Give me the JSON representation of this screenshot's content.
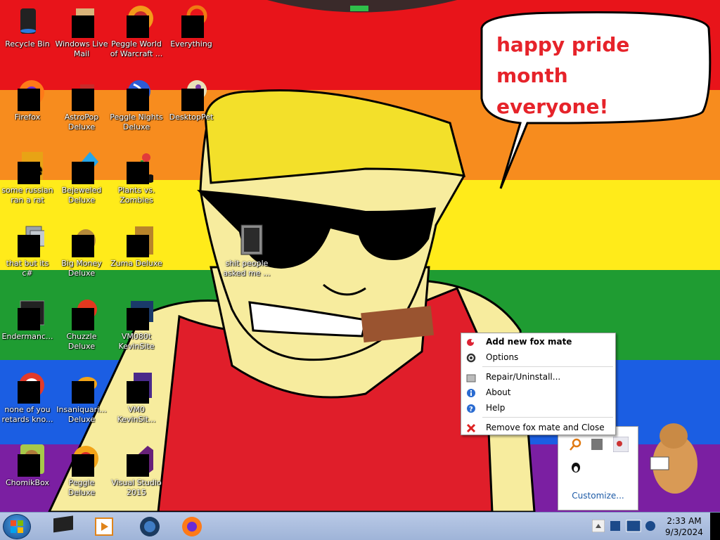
{
  "wallpaper": {
    "stripe_colors": [
      "#e8141a",
      "#f78c1e",
      "#ffeb1a",
      "#1f9c32",
      "#1b5ee3",
      "#7b1fa2"
    ],
    "speech_bubble": {
      "line1": "happy pride month",
      "line2": "everyone!"
    }
  },
  "desktop_icons": [
    {
      "label": "Recycle Bin",
      "icon": "recycle-bin-icon"
    },
    {
      "label": "Windows Live Mail",
      "icon": "windows-live-mail-icon"
    },
    {
      "label": "Peggle World of Warcraft ...",
      "icon": "peggle-wow-icon"
    },
    {
      "label": "Everything",
      "icon": "everything-search-icon"
    },
    {
      "label": "Firefox",
      "icon": "firefox-icon"
    },
    {
      "label": "AstroPop Deluxe",
      "icon": "astropop-icon"
    },
    {
      "label": "Peggle Nights Deluxe",
      "icon": "peggle-nights-icon"
    },
    {
      "label": "DesktopPet",
      "icon": "desktoppet-icon"
    },
    {
      "label": "some russian ran a rat",
      "icon": "folder-icon"
    },
    {
      "label": "Bejeweled Deluxe",
      "icon": "bejeweled-icon"
    },
    {
      "label": "Plants vs. Zombies",
      "icon": "plants-vs-zombies-icon"
    },
    {
      "label": "that but its c#",
      "icon": "shortcut-icon"
    },
    {
      "label": "Big Money Deluxe",
      "icon": "big-money-icon"
    },
    {
      "label": "Zuma Deluxe",
      "icon": "zuma-icon"
    },
    {
      "label": "shit people asked me ...",
      "icon": "folder-icon"
    },
    {
      "label": "Endermanc...",
      "icon": "console-app-icon"
    },
    {
      "label": "Chuzzle Deluxe",
      "icon": "chuzzle-icon"
    },
    {
      "label": "VM080t KevinSite",
      "icon": "vm-icon"
    },
    {
      "label": "none of you retards kno...",
      "icon": "browser-icon"
    },
    {
      "label": "Insaniquari... Deluxe",
      "icon": "insaniquarium-icon"
    },
    {
      "label": "VM0 KevinSit...",
      "icon": "vm-icon"
    },
    {
      "label": "ChomikBox",
      "icon": "chomikbox-icon"
    },
    {
      "label": "Peggle Deluxe",
      "icon": "peggle-icon"
    },
    {
      "label": "Visual Studio 2015",
      "icon": "visual-studio-icon"
    }
  ],
  "context_menu": {
    "items": [
      {
        "label": "Add new fox mate",
        "icon": "fox-icon",
        "bold": true
      },
      {
        "label": "Options",
        "icon": "gear-icon"
      },
      {
        "label": "Repair/Uninstall...",
        "icon": "installer-icon"
      },
      {
        "label": "About",
        "icon": "info-icon"
      },
      {
        "label": "Help",
        "icon": "help-icon"
      },
      {
        "label": "Remove fox mate and Close",
        "icon": "close-red-icon"
      }
    ]
  },
  "tray_overflow": {
    "customize_label": "Customize..."
  },
  "taskbar": {
    "pinned": [
      "terminal-icon",
      "media-player-icon",
      "globe-icon",
      "firefox-icon"
    ],
    "clock_time": "2:33 AM",
    "clock_date": "9/3/2024"
  }
}
